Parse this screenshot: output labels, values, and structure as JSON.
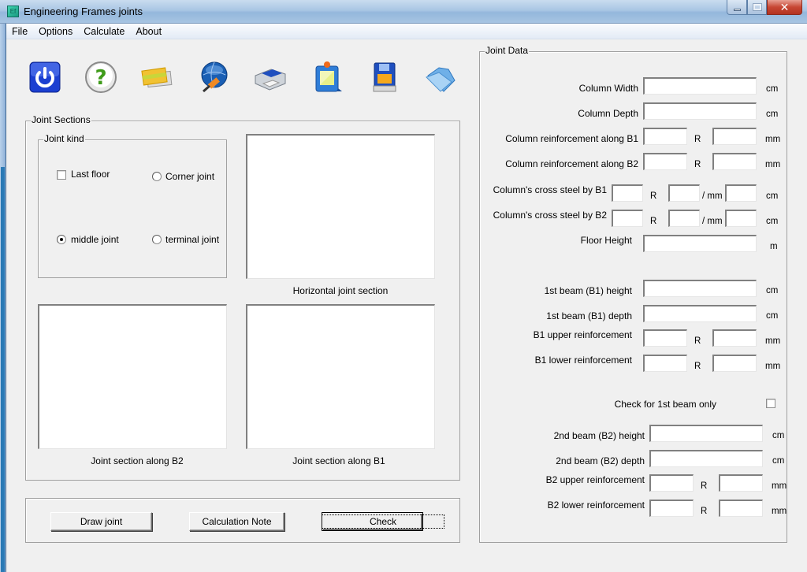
{
  "window": {
    "title": "Engineering Frames joints",
    "icon": "app-icon",
    "controls": {
      "minimize": "minimize",
      "maximize": "maximize",
      "close": "✕"
    }
  },
  "menu": [
    "File",
    "Options",
    "Calculate",
    "About"
  ],
  "toolbar": [
    {
      "name": "power-icon",
      "tooltip": "Exit"
    },
    {
      "name": "help-icon",
      "tooltip": "Help"
    },
    {
      "name": "cards-icon",
      "tooltip": "Cards"
    },
    {
      "name": "globe-brush-icon",
      "tooltip": "Web"
    },
    {
      "name": "printer-icon",
      "tooltip": "Print"
    },
    {
      "name": "frame-icon",
      "tooltip": "Picture"
    },
    {
      "name": "save-icon",
      "tooltip": "Save"
    },
    {
      "name": "folder-icon",
      "tooltip": "Open"
    }
  ],
  "joint_sections": {
    "legend": "Joint Sections",
    "joint_kind": {
      "legend": "Joint kind",
      "last_floor": {
        "label": "Last floor",
        "checked": false
      },
      "options": [
        {
          "label": "Corner joint",
          "checked": false
        },
        {
          "label": "middle joint",
          "checked": true
        },
        {
          "label": "terminal joint",
          "checked": false
        }
      ]
    },
    "captions": {
      "horizontal": "Horizontal joint section",
      "along_b2": "Joint section along B2",
      "along_b1": "Joint section along B1"
    }
  },
  "buttons": {
    "draw": "Draw joint",
    "calc_note": "Calculation Note",
    "check": "Check"
  },
  "joint_data": {
    "legend": "Joint Data",
    "column_width": {
      "label": "Column Width",
      "value": "",
      "unit": "cm"
    },
    "column_depth": {
      "label": "Column Depth",
      "value": "",
      "unit": "cm"
    },
    "col_reinf_b1": {
      "label": "Column reinforcement along B1",
      "count": "",
      "sep": "R",
      "dia": "",
      "unit": "mm"
    },
    "col_reinf_b2": {
      "label": "Column reinforcement along B2",
      "count": "",
      "sep": "R",
      "dia": "",
      "unit": "mm"
    },
    "cross_b1": {
      "label": "Column's cross steel by B1",
      "count": "",
      "sep": "R",
      "dia": "",
      "per": "/ mm",
      "spacing": "",
      "unit": "cm"
    },
    "cross_b2": {
      "label": "Column's cross steel by B2",
      "count": "",
      "sep": "R",
      "dia": "",
      "per": "/ mm",
      "spacing": "",
      "unit": "cm"
    },
    "floor_height": {
      "label": "Floor Height",
      "value": "",
      "unit": "m"
    },
    "b1_height": {
      "label": "1st beam (B1) height",
      "value": "",
      "unit": "cm"
    },
    "b1_depth": {
      "label": "1st beam (B1) depth",
      "value": "",
      "unit": "cm"
    },
    "b1_upper": {
      "label": "B1 upper reinforcement",
      "count": "",
      "sep": "R",
      "dia": "",
      "unit": "mm"
    },
    "b1_lower": {
      "label": "B1 lower reinforcement",
      "count": "",
      "sep": "R",
      "dia": "",
      "unit": "mm"
    },
    "check_first_beam": {
      "label": "Check for 1st beam only",
      "checked": false
    },
    "b2_height": {
      "label": "2nd beam (B2) height",
      "value": "",
      "unit": "cm"
    },
    "b2_depth": {
      "label": "2nd beam (B2) depth",
      "value": "",
      "unit": "cm"
    },
    "b2_upper": {
      "label": "B2 upper reinforcement",
      "count": "",
      "sep": "R",
      "dia": "",
      "unit": "mm"
    },
    "b2_lower": {
      "label": "B2 lower reinforcement",
      "count": "",
      "sep": "R",
      "dia": "",
      "unit": "mm"
    }
  }
}
